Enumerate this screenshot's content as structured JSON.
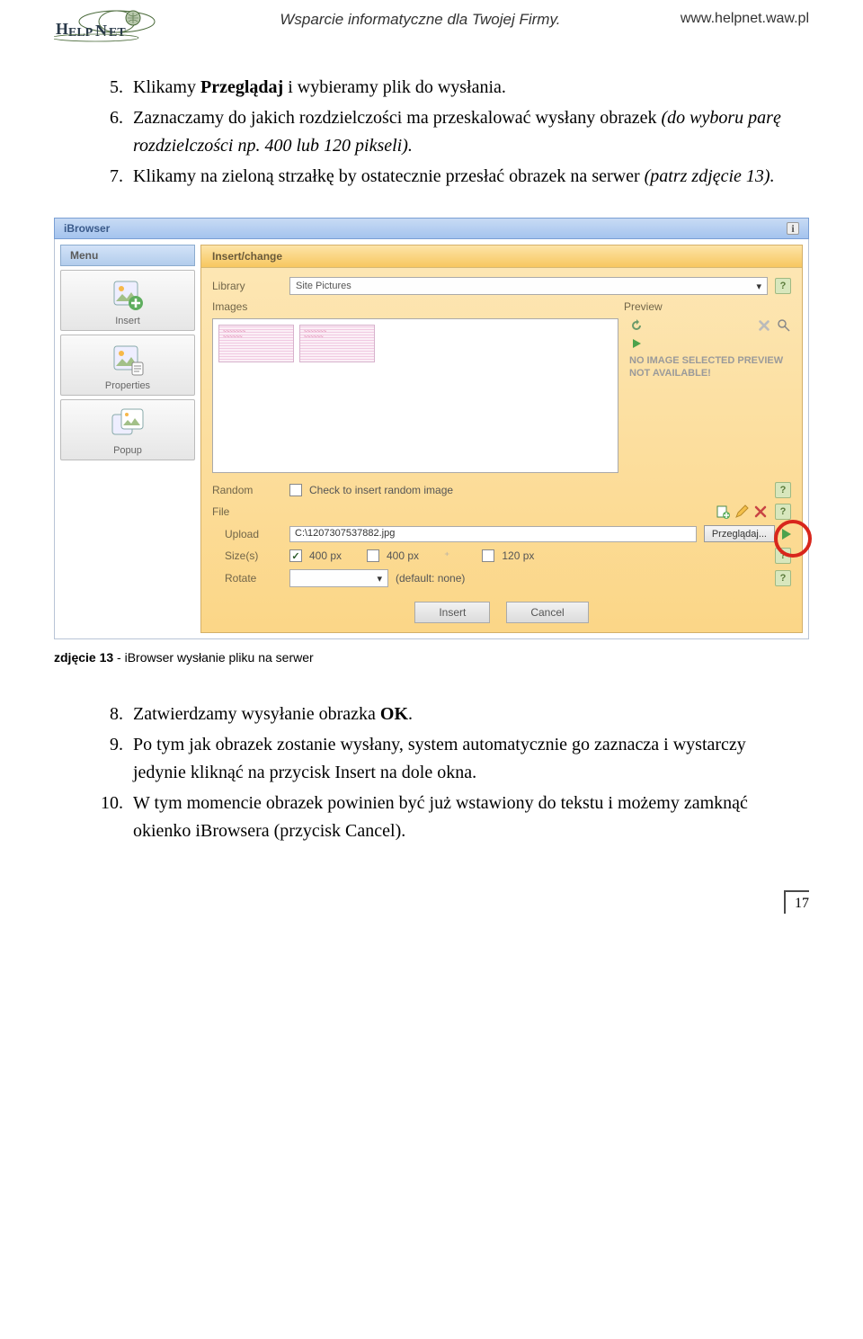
{
  "header": {
    "logo_text": "HELPNET",
    "center": "Wsparcie informatyczne dla Twojej Firmy.",
    "right": "www.helpnet.waw.pl"
  },
  "instructions_a": [
    {
      "n": 5,
      "pre": "Klikamy ",
      "bold": "Przeglądaj",
      "post": " i wybieramy plik do wysłania."
    },
    {
      "n": 6,
      "text": "Zaznaczamy do jakich rozdzielczości ma przeskalować wysłany obrazek ",
      "italic": "(do wyboru parę rozdzielczości np. 400 lub 120 pikseli)."
    },
    {
      "n": 7,
      "text": "Klikamy na zieloną strzałkę by ostatecznie przesłać obrazek na serwer ",
      "italic": "(patrz zdjęcie 13)."
    }
  ],
  "shot": {
    "title": "iBrowser",
    "menu_header": "Menu",
    "menu": [
      "Insert",
      "Properties",
      "Popup"
    ],
    "main_header": "Insert/change",
    "labels": {
      "library": "Library",
      "images": "Images",
      "preview": "Preview",
      "random": "Random",
      "random_text": "Check to insert random image",
      "file": "File",
      "upload": "Upload",
      "sizes": "Size(s)",
      "rotate": "Rotate",
      "rotate_default": "(default: none)"
    },
    "library_value": "Site Pictures",
    "noimg": "NO IMAGE SELECTED PREVIEW NOT AVAILABLE!",
    "upload_path": "C:\\1207307537882.jpg",
    "browse_label": "Przeglądaj...",
    "sizes": [
      "400 px",
      "400 px",
      "120 px"
    ],
    "buttons": {
      "insert": "Insert",
      "cancel": "Cancel"
    }
  },
  "caption": {
    "bold": "zdjęcie 13",
    "rest": " - iBrowser wysłanie pliku na serwer"
  },
  "instructions_b": [
    {
      "n": 8,
      "pre": "Zatwierdzamy wysyłanie obrazka ",
      "bold": "OK",
      "post": "."
    },
    {
      "n": 9,
      "text": "Po tym jak obrazek zostanie wysłany, system automatycznie go zaznacza i wystarczy jedynie kliknąć na przycisk Insert na dole okna."
    },
    {
      "n": 10,
      "text": "W tym momencie obrazek powinien być już wstawiony do tekstu i możemy zamknąć okienko iBrowsera (przycisk Cancel)."
    }
  ],
  "pagenum": "17",
  "chart_data": null
}
